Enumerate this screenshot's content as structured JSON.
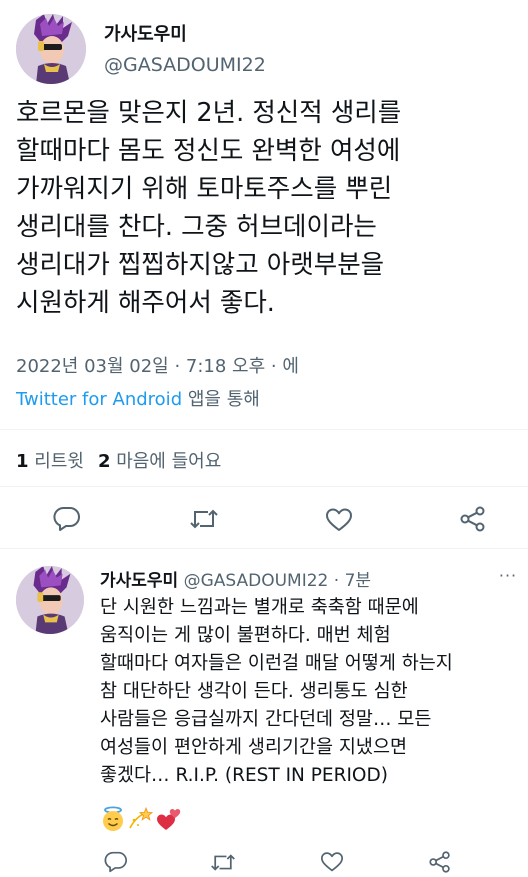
{
  "tweet": {
    "display_name": "가사도우미",
    "handle": "@GASADOUMI22",
    "text_lines": [
      "호르몬을 맞은지 2년. 정신적 생리를",
      "할때마다 몸도 정신도 완벽한 여성에",
      "가까워지기 위해 토마토주스를 뿌린",
      "생리대를 찬다. 그중 허브데이라는",
      "생리대가 찝찝하지않고 아랫부분을",
      "시원하게 해주어서 좋다."
    ],
    "timestamp": "2022년 03월 02일 · 7:18 오후 · 에",
    "source_app": "Twitter for Android",
    "source_suffix": " 앱을 통해",
    "retweet_count": "1",
    "retweet_label": " 리트윗",
    "like_count": "2",
    "like_label": " 마음에 들어요",
    "actions": [
      "reply-icon",
      "retweet-icon",
      "like-icon",
      "share-icon"
    ]
  },
  "reply": {
    "display_name": "가사도우미",
    "handle_time": " @GASADOUMI22 · 7분",
    "more_label": "···",
    "text_lines": [
      "단 시원한 느낌과는 별개로 축축함 때문에",
      "움직이는 게 많이 불편하다. 매번 체험",
      "할때마다 여자들은 이런걸 매달 어떻게 하는지",
      "참 대단하단 생각이 든다. 생리통도 심한",
      "사람들은 응급실까지 간다던데 정말… 모든",
      "여성들이 편안하게 생리기간을 지냈으면",
      "좋겠다… R.I.P. (REST IN PERIOD)"
    ],
    "emojis": [
      "smiling-face-with-halo-icon",
      "dizzy-star-icon",
      "two-hearts-icon"
    ],
    "actions": [
      "reply-icon",
      "retweet-icon",
      "like-icon",
      "share-icon"
    ]
  },
  "colors": {
    "text": "#0f1419",
    "secondary": "#536471",
    "link": "#1d9bf0",
    "divider": "#eff3f4"
  }
}
